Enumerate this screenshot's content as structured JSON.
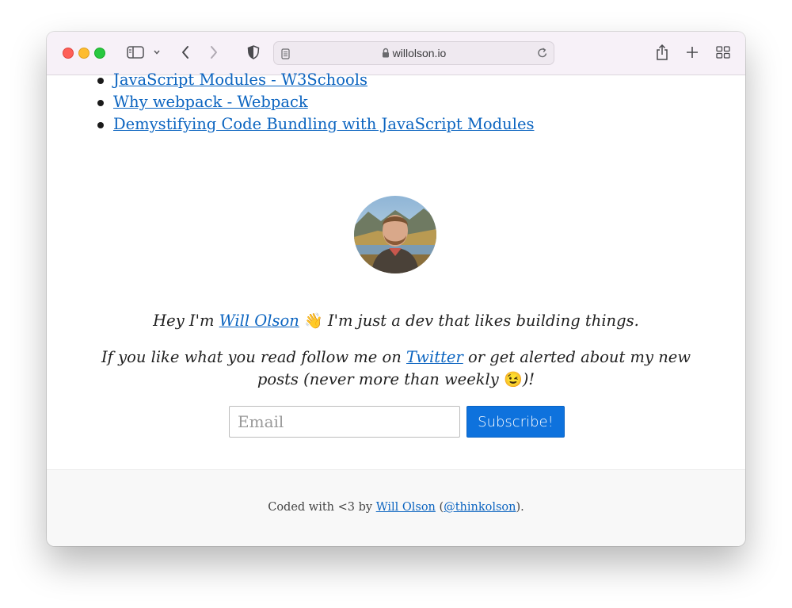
{
  "browser": {
    "url": "willolson.io"
  },
  "references": [
    {
      "label": "JavaScript Modules - W3Schools"
    },
    {
      "label": "Why webpack - Webpack"
    },
    {
      "label": "Demystifying Code Bundling with JavaScript Modules"
    }
  ],
  "bio": {
    "prefix": "Hey I'm ",
    "name_link": "Will Olson",
    "wave": "👋",
    "suffix": " I'm just a dev that likes building things.",
    "follow_prefix": "If you like what you read follow me on ",
    "twitter_link": "Twitter",
    "follow_mid": " or get alerted about my new posts (never more than weekly ",
    "wink": "😉",
    "follow_end": ")!"
  },
  "subscribe_form": {
    "email_placeholder": "Email",
    "button_label": "Subscribe!"
  },
  "footer": {
    "prefix": "Coded with <3 by ",
    "name_link": "Will Olson",
    "open_paren": " (",
    "handle_link": "@thinkolson",
    "close": ")."
  },
  "colors": {
    "link": "#0b64c0",
    "button": "#0e72dd",
    "toolbar": "#f7f1f8"
  }
}
